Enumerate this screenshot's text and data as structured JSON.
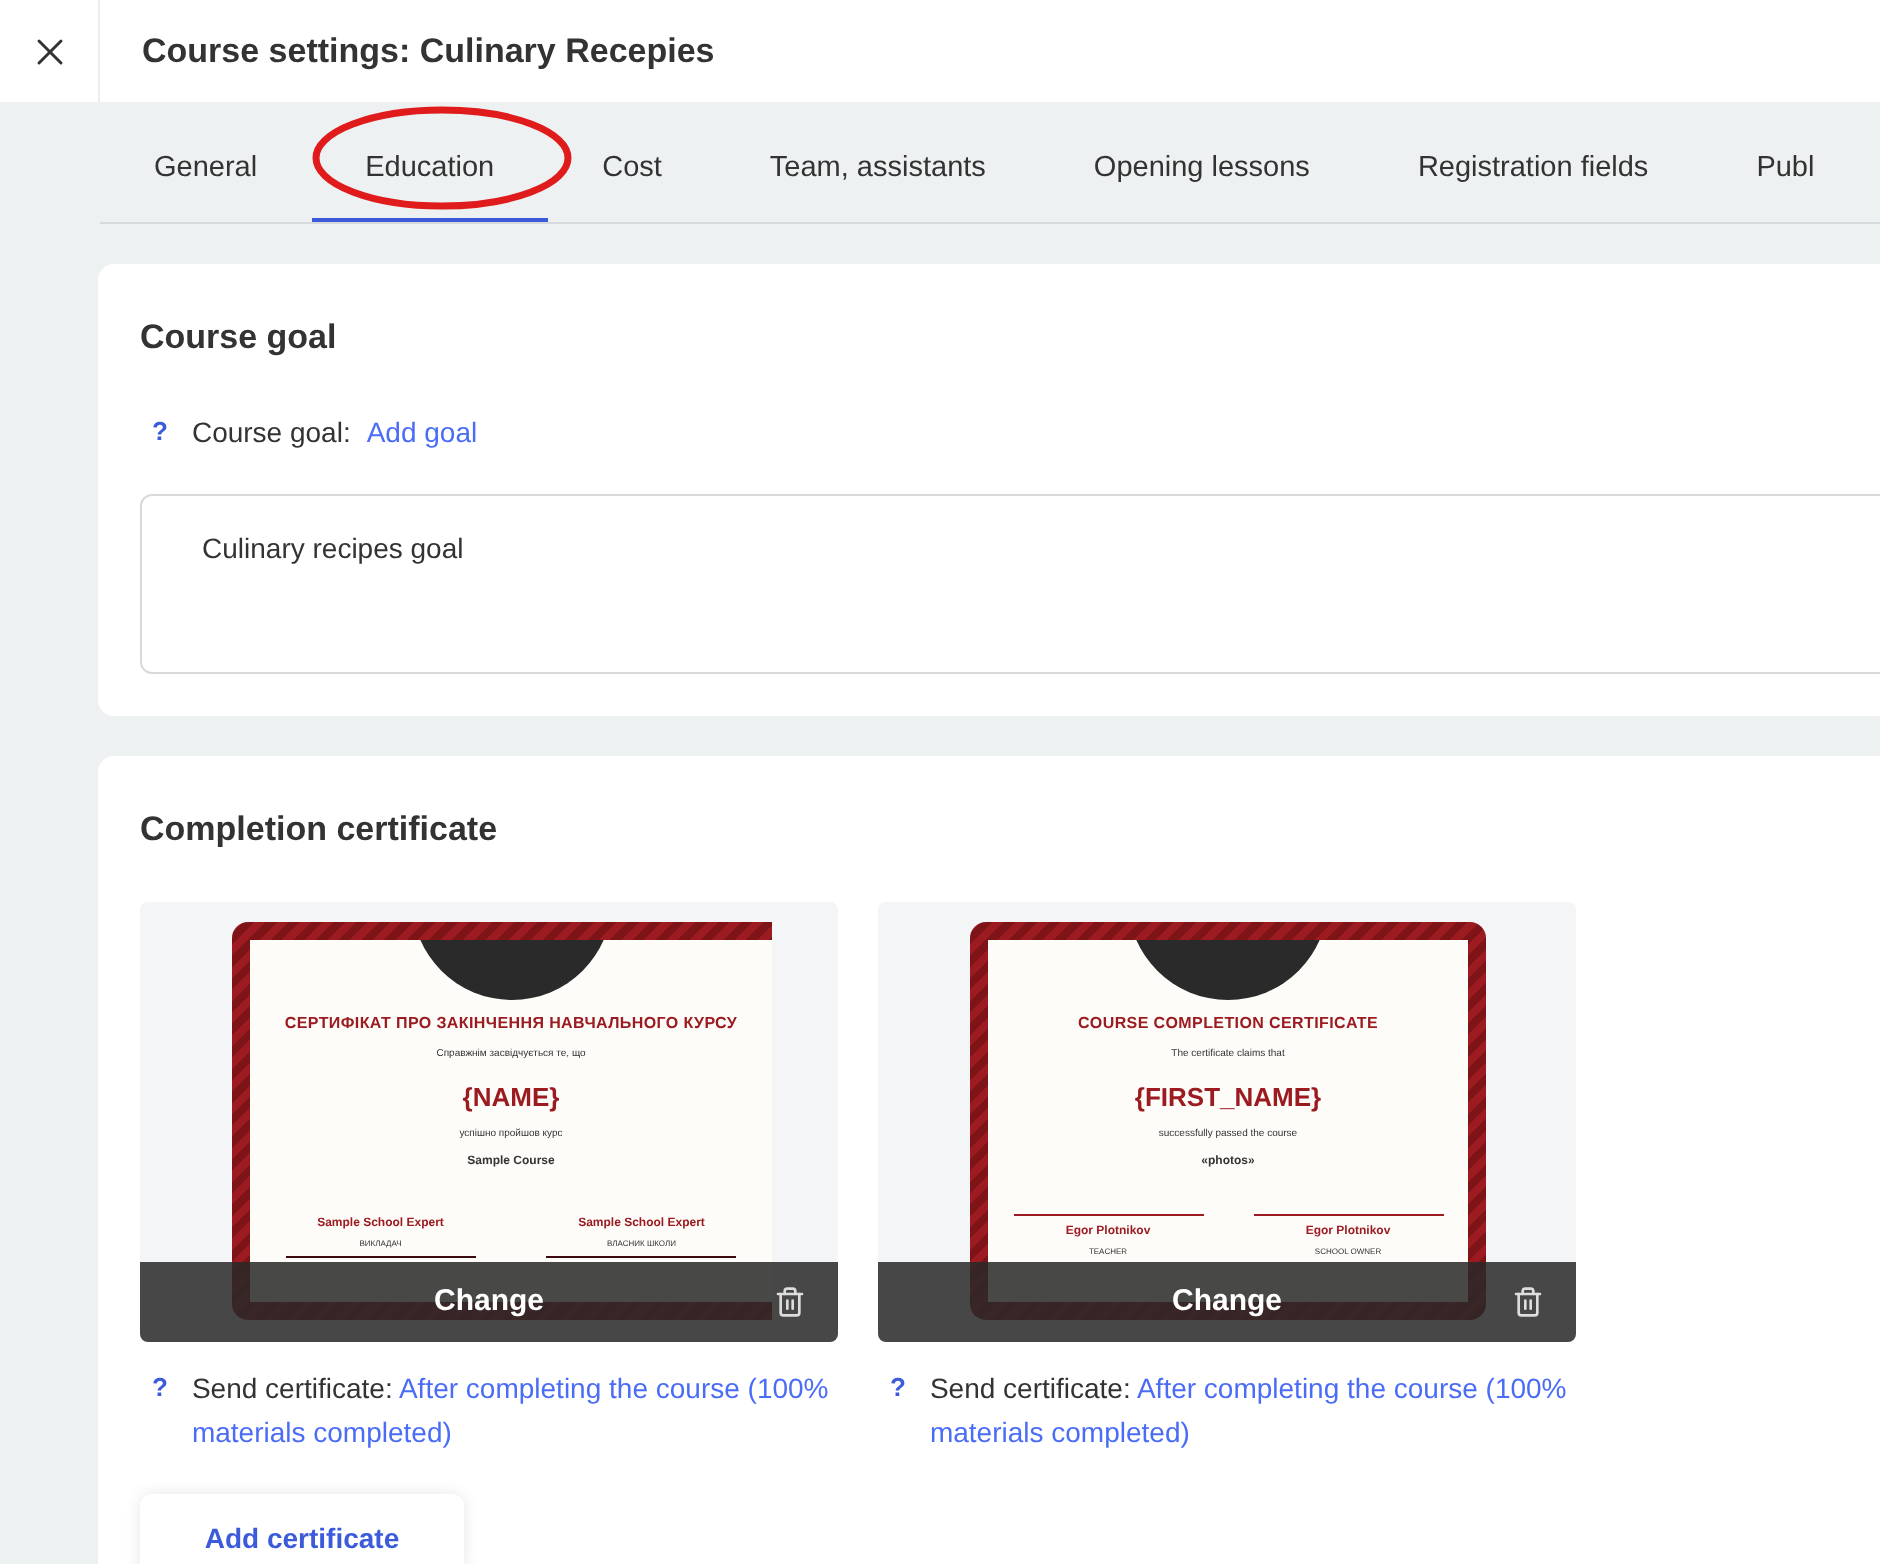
{
  "window": {
    "title": "Course settings: Culinary Recepies"
  },
  "tabs": [
    {
      "label": "General",
      "selected": false
    },
    {
      "label": "Education",
      "selected": true
    },
    {
      "label": "Cost",
      "selected": false
    },
    {
      "label": "Team, assistants",
      "selected": false
    },
    {
      "label": "Opening lessons",
      "selected": false
    },
    {
      "label": "Registration fields",
      "selected": false
    },
    {
      "label": "Publ",
      "selected": false
    }
  ],
  "course_goal": {
    "heading": "Course goal",
    "help": "?",
    "label": "Course goal:",
    "link": "Add goal",
    "value": "Culinary recipes goal"
  },
  "certificate_section": {
    "heading": "Completion certificate",
    "certificates": [
      {
        "kind": "lines_below",
        "title": "СЕРТИФІКАТ ПРО ЗАКІНЧЕННЯ НАВЧАЛЬНОГО КУРСУ",
        "intro": "Справжнім засвідчується те, що",
        "name_field": "{NAME}",
        "passed": "успішно пройшов курс",
        "course": "Sample Course",
        "signers": [
          {
            "name": "Sample School Expert",
            "role": "ВИКЛАДАЧ"
          },
          {
            "name": "Sample School Expert",
            "role": "ВЛАСНИК ШКОЛИ"
          }
        ],
        "change": "Change",
        "help": "?",
        "send_label": "Send certificate:",
        "send_link": "After completing the course (100% materials completed)"
      },
      {
        "kind": "lines_above",
        "title": "COURSE COMPLETION CERTIFICATE",
        "intro": "The certificate claims that",
        "name_field": "{FIRST_NAME}",
        "passed": "successfully passed the course",
        "course": "«photos»",
        "signers": [
          {
            "name": "Egor Plotnikov",
            "role": "TEACHER"
          },
          {
            "name": "Egor Plotnikov",
            "role": "SCHOOL OWNER"
          }
        ],
        "change": "Change",
        "help": "?",
        "send_label": "Send certificate:",
        "send_link": "After completing the course (100% materials completed)"
      }
    ],
    "add_button": "Add certificate"
  }
}
